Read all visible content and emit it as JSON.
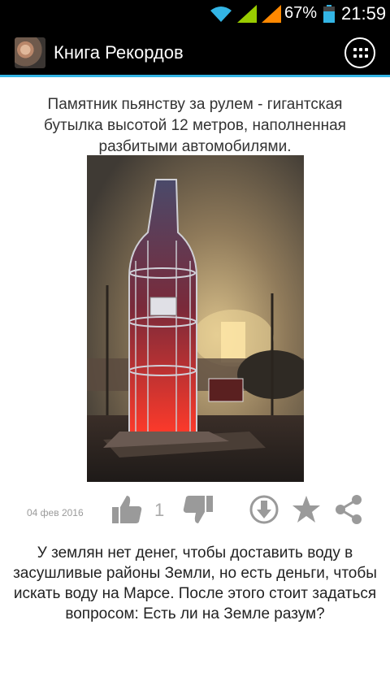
{
  "status_bar": {
    "battery_percent": "67%",
    "time": "21:59",
    "icons": [
      "wifi-icon",
      "signal-icon",
      "signal-icon",
      "battery-icon"
    ],
    "colors": {
      "wifi": "#33b5e5",
      "signal": "#99cc00",
      "signal_alt": "#ff8800"
    }
  },
  "action_bar": {
    "title": "Книга Рекордов",
    "accent_color": "#33b5e5",
    "menu_icon": "grid-menu-icon"
  },
  "post": {
    "caption": "Памятник пьянству за рулем - гигантская бутылка высотой 12 метров, наполненная разбитыми автомобилями.",
    "date": "04 фев 2016",
    "like_count": "1",
    "actions": [
      "like-icon",
      "dislike-icon",
      "download-icon",
      "star-icon",
      "share-icon"
    ]
  },
  "next_post": {
    "text": "У землян нет денег, чтобы доставить воду в засушливые районы Земли, но есть деньги, чтобы искать воду на Марсе. После этого стоит задаться вопросом: Есть ли на Земле разум?"
  }
}
